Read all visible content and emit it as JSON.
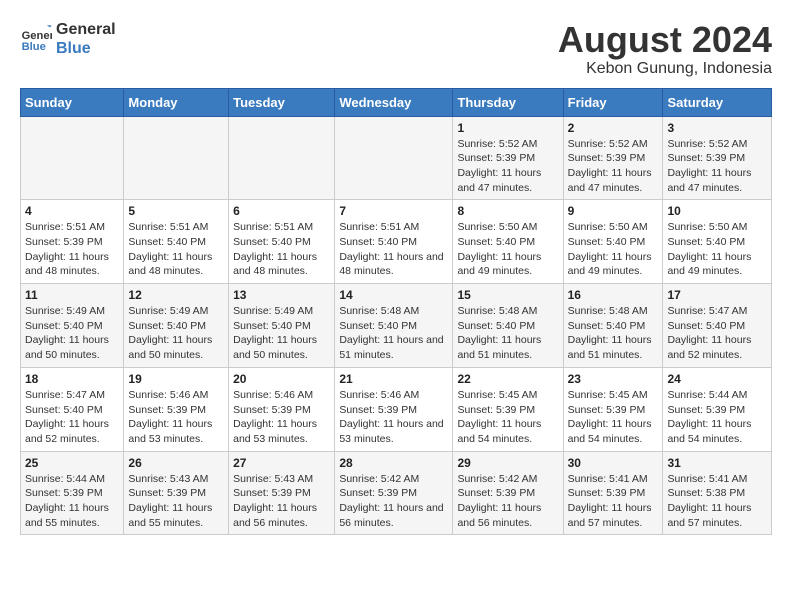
{
  "logo": {
    "line1": "General",
    "line2": "Blue"
  },
  "title": "August 2024",
  "subtitle": "Kebon Gunung, Indonesia",
  "days_header": [
    "Sunday",
    "Monday",
    "Tuesday",
    "Wednesday",
    "Thursday",
    "Friday",
    "Saturday"
  ],
  "weeks": [
    [
      {
        "day": "",
        "info": ""
      },
      {
        "day": "",
        "info": ""
      },
      {
        "day": "",
        "info": ""
      },
      {
        "day": "",
        "info": ""
      },
      {
        "day": "1",
        "info": "Sunrise: 5:52 AM\nSunset: 5:39 PM\nDaylight: 11 hours and 47 minutes."
      },
      {
        "day": "2",
        "info": "Sunrise: 5:52 AM\nSunset: 5:39 PM\nDaylight: 11 hours and 47 minutes."
      },
      {
        "day": "3",
        "info": "Sunrise: 5:52 AM\nSunset: 5:39 PM\nDaylight: 11 hours and 47 minutes."
      }
    ],
    [
      {
        "day": "4",
        "info": "Sunrise: 5:51 AM\nSunset: 5:39 PM\nDaylight: 11 hours and 48 minutes."
      },
      {
        "day": "5",
        "info": "Sunrise: 5:51 AM\nSunset: 5:40 PM\nDaylight: 11 hours and 48 minutes."
      },
      {
        "day": "6",
        "info": "Sunrise: 5:51 AM\nSunset: 5:40 PM\nDaylight: 11 hours and 48 minutes."
      },
      {
        "day": "7",
        "info": "Sunrise: 5:51 AM\nSunset: 5:40 PM\nDaylight: 11 hours and 48 minutes."
      },
      {
        "day": "8",
        "info": "Sunrise: 5:50 AM\nSunset: 5:40 PM\nDaylight: 11 hours and 49 minutes."
      },
      {
        "day": "9",
        "info": "Sunrise: 5:50 AM\nSunset: 5:40 PM\nDaylight: 11 hours and 49 minutes."
      },
      {
        "day": "10",
        "info": "Sunrise: 5:50 AM\nSunset: 5:40 PM\nDaylight: 11 hours and 49 minutes."
      }
    ],
    [
      {
        "day": "11",
        "info": "Sunrise: 5:49 AM\nSunset: 5:40 PM\nDaylight: 11 hours and 50 minutes."
      },
      {
        "day": "12",
        "info": "Sunrise: 5:49 AM\nSunset: 5:40 PM\nDaylight: 11 hours and 50 minutes."
      },
      {
        "day": "13",
        "info": "Sunrise: 5:49 AM\nSunset: 5:40 PM\nDaylight: 11 hours and 50 minutes."
      },
      {
        "day": "14",
        "info": "Sunrise: 5:48 AM\nSunset: 5:40 PM\nDaylight: 11 hours and 51 minutes."
      },
      {
        "day": "15",
        "info": "Sunrise: 5:48 AM\nSunset: 5:40 PM\nDaylight: 11 hours and 51 minutes."
      },
      {
        "day": "16",
        "info": "Sunrise: 5:48 AM\nSunset: 5:40 PM\nDaylight: 11 hours and 51 minutes."
      },
      {
        "day": "17",
        "info": "Sunrise: 5:47 AM\nSunset: 5:40 PM\nDaylight: 11 hours and 52 minutes."
      }
    ],
    [
      {
        "day": "18",
        "info": "Sunrise: 5:47 AM\nSunset: 5:40 PM\nDaylight: 11 hours and 52 minutes."
      },
      {
        "day": "19",
        "info": "Sunrise: 5:46 AM\nSunset: 5:39 PM\nDaylight: 11 hours and 53 minutes."
      },
      {
        "day": "20",
        "info": "Sunrise: 5:46 AM\nSunset: 5:39 PM\nDaylight: 11 hours and 53 minutes."
      },
      {
        "day": "21",
        "info": "Sunrise: 5:46 AM\nSunset: 5:39 PM\nDaylight: 11 hours and 53 minutes."
      },
      {
        "day": "22",
        "info": "Sunrise: 5:45 AM\nSunset: 5:39 PM\nDaylight: 11 hours and 54 minutes."
      },
      {
        "day": "23",
        "info": "Sunrise: 5:45 AM\nSunset: 5:39 PM\nDaylight: 11 hours and 54 minutes."
      },
      {
        "day": "24",
        "info": "Sunrise: 5:44 AM\nSunset: 5:39 PM\nDaylight: 11 hours and 54 minutes."
      }
    ],
    [
      {
        "day": "25",
        "info": "Sunrise: 5:44 AM\nSunset: 5:39 PM\nDaylight: 11 hours and 55 minutes."
      },
      {
        "day": "26",
        "info": "Sunrise: 5:43 AM\nSunset: 5:39 PM\nDaylight: 11 hours and 55 minutes."
      },
      {
        "day": "27",
        "info": "Sunrise: 5:43 AM\nSunset: 5:39 PM\nDaylight: 11 hours and 56 minutes."
      },
      {
        "day": "28",
        "info": "Sunrise: 5:42 AM\nSunset: 5:39 PM\nDaylight: 11 hours and 56 minutes."
      },
      {
        "day": "29",
        "info": "Sunrise: 5:42 AM\nSunset: 5:39 PM\nDaylight: 11 hours and 56 minutes."
      },
      {
        "day": "30",
        "info": "Sunrise: 5:41 AM\nSunset: 5:39 PM\nDaylight: 11 hours and 57 minutes."
      },
      {
        "day": "31",
        "info": "Sunrise: 5:41 AM\nSunset: 5:38 PM\nDaylight: 11 hours and 57 minutes."
      }
    ]
  ]
}
